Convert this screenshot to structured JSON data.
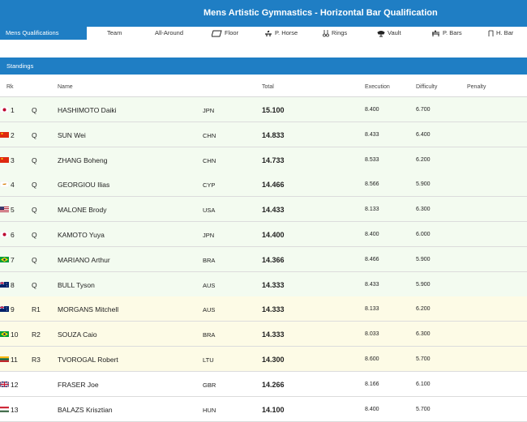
{
  "header": {
    "title": "Mens Artistic Gymnastics - Horizontal Bar Qualification"
  },
  "nav": {
    "tabs": [
      {
        "label": "Mens Qualifications",
        "icon": ""
      },
      {
        "label": "Team",
        "icon": ""
      },
      {
        "label": "All-Around",
        "icon": ""
      },
      {
        "label": "Floor",
        "icon": "floor-icon"
      },
      {
        "label": "P. Horse",
        "icon": "pommel-horse-icon"
      },
      {
        "label": "Rings",
        "icon": "rings-icon"
      },
      {
        "label": "Vault",
        "icon": "vault-icon"
      },
      {
        "label": "P. Bars",
        "icon": "parallel-bars-icon"
      },
      {
        "label": "H. Bar",
        "icon": "horizontal-bar-icon"
      }
    ],
    "active_color": "#1f7ec4"
  },
  "standings": {
    "label": "Standings",
    "columns": {
      "rk": "Rk",
      "name": "Name",
      "total": "Total",
      "execution": "Execution",
      "difficulty": "Difficulty",
      "penalty": "Penalty"
    },
    "rows": [
      {
        "rk": "1",
        "qual": "Q",
        "name": "HASHIMOTO Daiki",
        "noc": "JPN",
        "total": "15.100",
        "execution": "8.400",
        "difficulty": "6.700",
        "status": "q"
      },
      {
        "rk": "2",
        "qual": "Q",
        "name": "SUN Wei",
        "noc": "CHN",
        "total": "14.833",
        "execution": "8.433",
        "difficulty": "6.400",
        "status": "q"
      },
      {
        "rk": "3",
        "qual": "Q",
        "name": "ZHANG Boheng",
        "noc": "CHN",
        "total": "14.733",
        "execution": "8.533",
        "difficulty": "6.200",
        "status": "q"
      },
      {
        "rk": "4",
        "qual": "Q",
        "name": "GEORGIOU Ilias",
        "noc": "CYP",
        "total": "14.466",
        "execution": "8.566",
        "difficulty": "5.900",
        "status": "q"
      },
      {
        "rk": "5",
        "qual": "Q",
        "name": "MALONE Brody",
        "noc": "USA",
        "total": "14.433",
        "execution": "8.133",
        "difficulty": "6.300",
        "status": "q"
      },
      {
        "rk": "6",
        "qual": "Q",
        "name": "KAMOTO Yuya",
        "noc": "JPN",
        "total": "14.400",
        "execution": "8.400",
        "difficulty": "6.000",
        "status": "q"
      },
      {
        "rk": "7",
        "qual": "Q",
        "name": "MARIANO Arthur",
        "noc": "BRA",
        "total": "14.366",
        "execution": "8.466",
        "difficulty": "5.900",
        "status": "q"
      },
      {
        "rk": "8",
        "qual": "Q",
        "name": "BULL Tyson",
        "noc": "AUS",
        "total": "14.333",
        "execution": "8.433",
        "difficulty": "5.900",
        "status": "q"
      },
      {
        "rk": "9",
        "qual": "R1",
        "name": "MORGANS Mitchell",
        "noc": "AUS",
        "total": "14.333",
        "execution": "8.133",
        "difficulty": "6.200",
        "status": "r"
      },
      {
        "rk": "10",
        "qual": "R2",
        "name": "SOUZA Caio",
        "noc": "BRA",
        "total": "14.333",
        "execution": "8.033",
        "difficulty": "6.300",
        "status": "r"
      },
      {
        "rk": "11",
        "qual": "R3",
        "name": "TVOROGAL Robert",
        "noc": "LTU",
        "total": "14.300",
        "execution": "8.600",
        "difficulty": "5.700",
        "status": "r"
      },
      {
        "rk": "12",
        "qual": "",
        "name": "FRASER Joe",
        "noc": "GBR",
        "total": "14.266",
        "execution": "8.166",
        "difficulty": "6.100",
        "status": "n"
      },
      {
        "rk": "13",
        "qual": "",
        "name": "BALAZS Krisztian",
        "noc": "HUN",
        "total": "14.100",
        "execution": "8.400",
        "difficulty": "5.700",
        "status": "n"
      }
    ]
  },
  "colors": {
    "brand": "#1f7ec4",
    "qualified_row": "#f3fbf0",
    "reserve_row": "#fdfbe6"
  }
}
